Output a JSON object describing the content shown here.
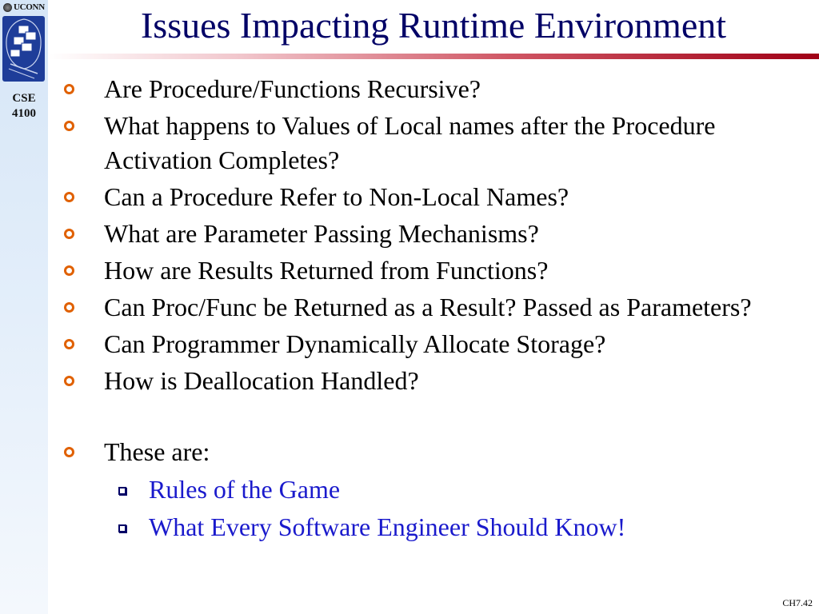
{
  "branding": {
    "university": "UCONN",
    "course_line1": "CSE",
    "course_line2": "4100"
  },
  "slide": {
    "title": "Issues Impacting Runtime Environment",
    "bullets": [
      "Are Procedure/Functions Recursive?",
      "What happens to Values of Local names after the Procedure Activation Completes?",
      "Can a Procedure Refer to Non-Local Names?",
      "What are Parameter Passing Mechanisms?",
      "How are Results Returned from Functions?",
      "Can Proc/Func be Returned as a Result? Passed as Parameters?",
      "Can Programmer Dynamically Allocate Storage?",
      "How is Deallocation Handled?"
    ],
    "summary_bullet": "These are:",
    "sub_bullets": [
      "Rules of the Game",
      "What Every Software Engineer Should Know!"
    ],
    "page_number": "CH7.42"
  },
  "colors": {
    "title": "#000066",
    "bullet_marker": "#e06000",
    "sub_bullet_text": "#1a1acc",
    "title_bar_end": "#a00016",
    "sidebar": "#d6e6f7"
  },
  "icons": {
    "bullet": "circle-bullet-icon",
    "sub_bullet": "square-bullet-icon",
    "logo": "department-logo-icon"
  }
}
